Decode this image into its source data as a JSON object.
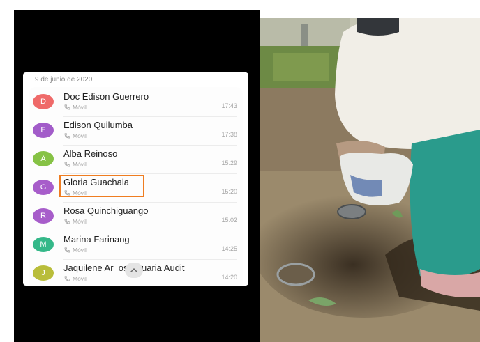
{
  "call_log": {
    "date_header": "9 de junio de 2020",
    "entries": [
      {
        "initial": "D",
        "name": "Doc Edison Guerrero",
        "type": "Móvil",
        "time": "17:43",
        "avatar_color": "#ef6a69"
      },
      {
        "initial": "E",
        "name": "Edison Quilumba",
        "type": "Móvil",
        "time": "17:38",
        "avatar_color": "#a25cc9"
      },
      {
        "initial": "A",
        "name": "Alba Reinoso",
        "type": "Móvil",
        "time": "15:29",
        "avatar_color": "#86c245"
      },
      {
        "initial": "G",
        "name": "Gloria Guachala",
        "type": "Móvil",
        "time": "15:20",
        "avatar_color": "#a75dca"
      },
      {
        "initial": "R",
        "name": "Rosa Quinchiguango",
        "type": "Móvil",
        "time": "15:02",
        "avatar_color": "#a75dca"
      },
      {
        "initial": "M",
        "name": "Marina Farinang",
        "type": "Móvil",
        "time": "14:25",
        "avatar_color": "#35b889"
      },
      {
        "initial": "J",
        "name": "Jaquilene Ar  os Usuaria Audit",
        "type": "Móvil",
        "time": "14:20",
        "avatar_color": "#b9bd3a"
      }
    ]
  },
  "highlight_color": "#ef7d21",
  "collapse_icon": "chevron-up-icon",
  "call_type_icon": "call-icon"
}
